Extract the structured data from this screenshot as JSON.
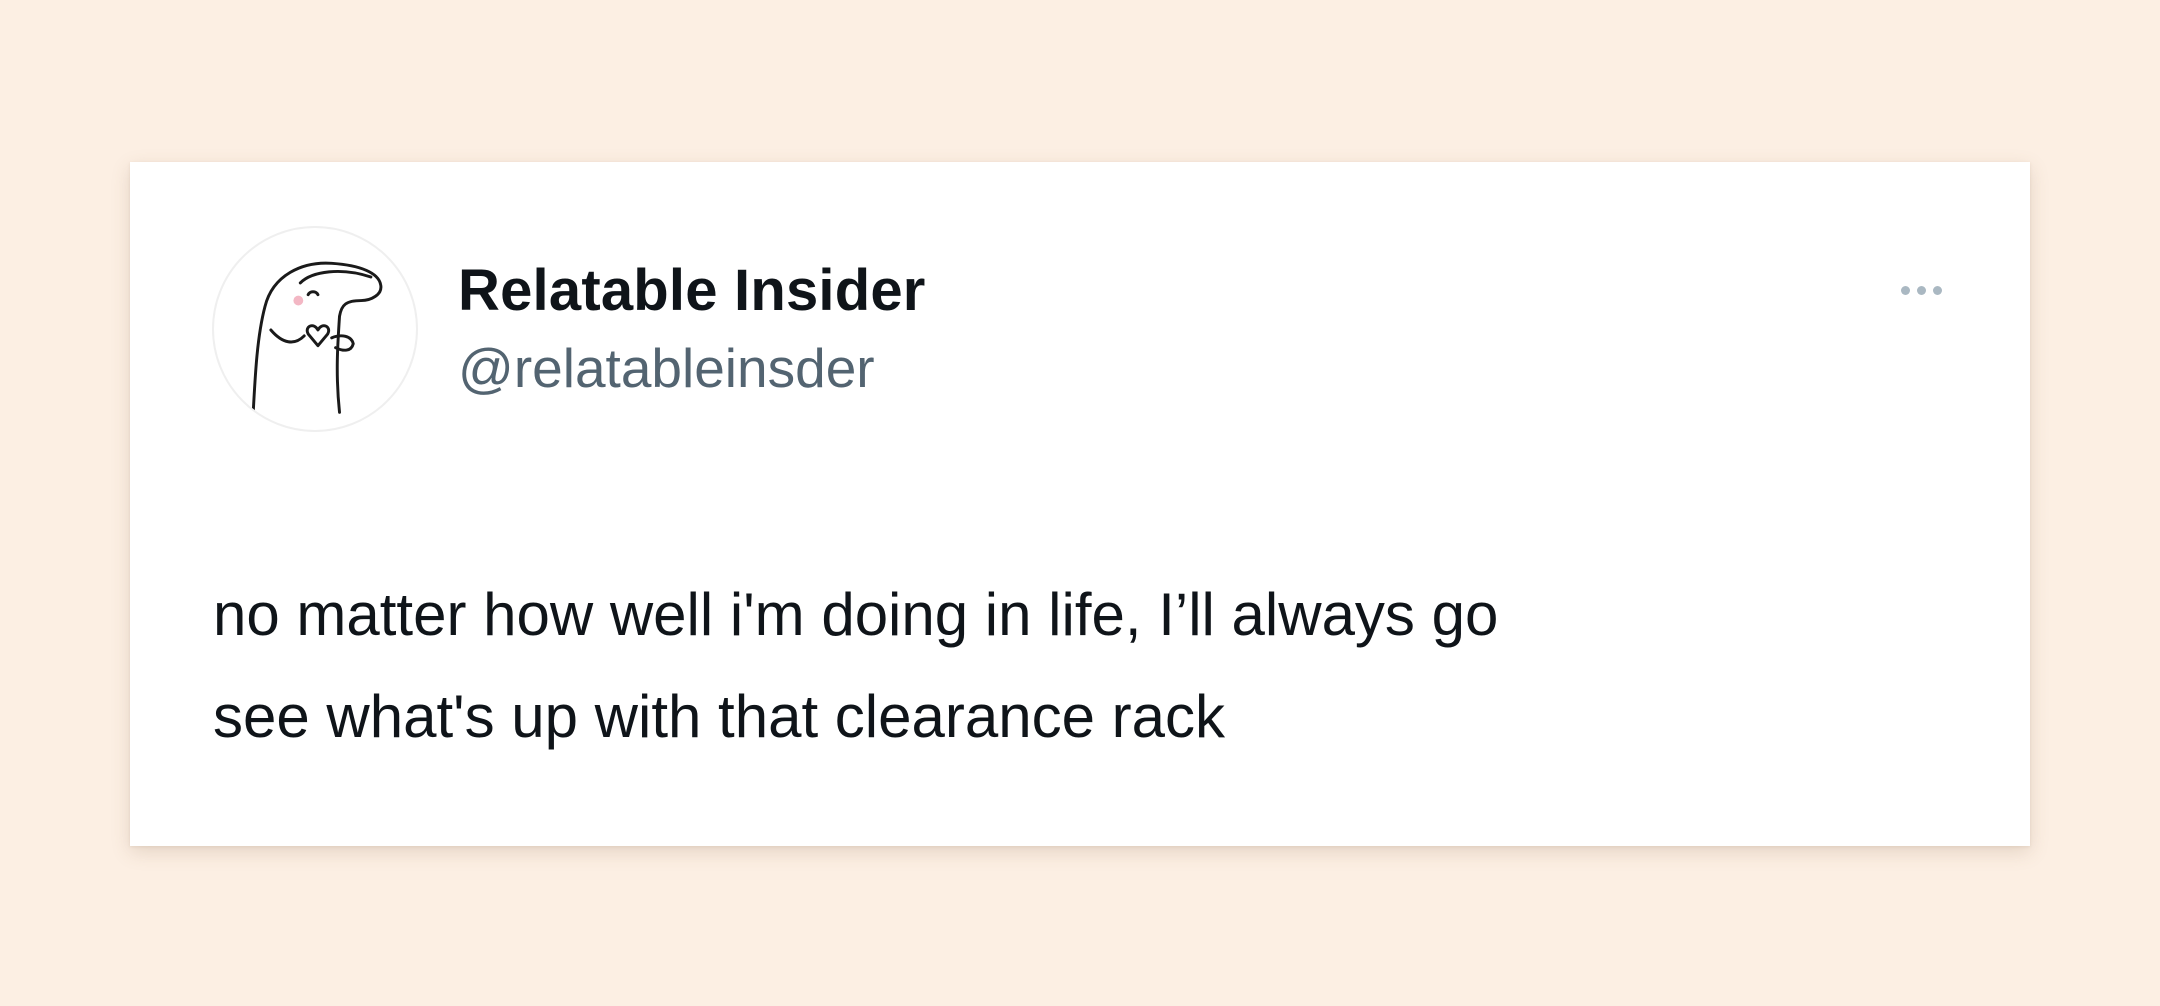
{
  "tweet": {
    "display_name": "Relatable Insider",
    "handle": "@relatableinsder",
    "text": "no matter how well i'm doing in life, I’ll always go\nsee what's up with that clearance rack",
    "avatar_icon": "cartoon-character-holding-heart-icon",
    "more_icon": "more-options-ellipsis-icon"
  },
  "colors": {
    "page_background": "#fcefe3",
    "card_background": "#ffffff",
    "name_text": "#0f1419",
    "handle_text": "#536471",
    "more_icon": "#aab8c2"
  }
}
